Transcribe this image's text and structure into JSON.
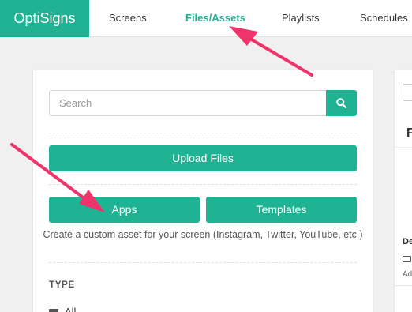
{
  "app": {
    "logo": "OptiSigns"
  },
  "nav": {
    "items": [
      {
        "label": "Screens"
      },
      {
        "label": "Files/Assets"
      },
      {
        "label": "Playlists"
      },
      {
        "label": "Schedules"
      }
    ],
    "active": "Files/Assets"
  },
  "panel": {
    "search": {
      "placeholder": "Search",
      "value": ""
    },
    "upload_label": "Upload Files",
    "apps_label": "Apps",
    "templates_label": "Templates",
    "help_text": "Create a custom asset for your screen (Instagram, Twitter, YouTube, etc.)",
    "type_heading": "TYPE",
    "type_all": "All"
  },
  "right_panel": {
    "heading_fragment": "F",
    "item_title_fragment": "De",
    "item_meta_fragment": "Ad"
  },
  "colors": {
    "brand": "#1fb394",
    "annotation_arrow": "#f0336b",
    "background": "#f0f0f0"
  },
  "icons": [
    "search-icon",
    "folder-icon"
  ]
}
